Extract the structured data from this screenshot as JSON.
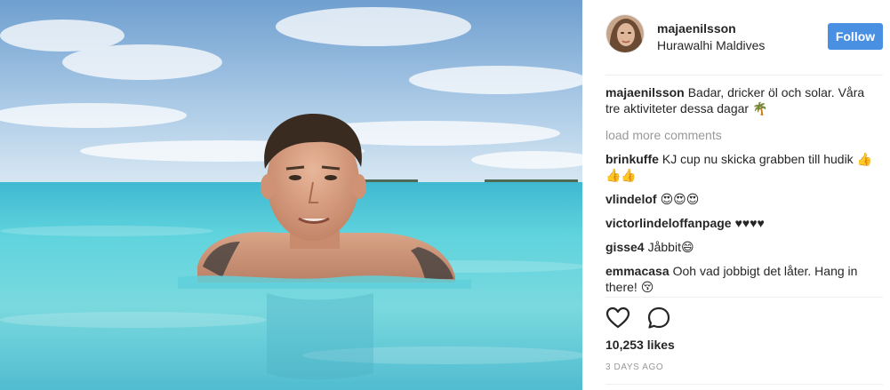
{
  "post": {
    "header": {
      "username": "majaenilsson",
      "location": "Hurawalhi Maldives",
      "follow_label": "Follow"
    },
    "caption": {
      "username": "majaenilsson",
      "text": "Badar, dricker öl och solar. Våra tre aktiviteter dessa dagar 🌴"
    },
    "load_more_label": "load more comments",
    "comments": [
      {
        "username": "brinkuffe",
        "text": "KJ cup nu skicka grabben till hudik 👍👍👍"
      },
      {
        "username": "vlindelof",
        "text": "😍😍😍"
      },
      {
        "username": "victorlindeloffanpage",
        "text": "♥♥♥♥"
      },
      {
        "username": "gisse4",
        "text": "Jåbbit😄"
      },
      {
        "username": "emmacasa",
        "text": "Ooh vad jobbigt det låter. Hang in there! 😚"
      }
    ],
    "actions": {
      "like_icon": "heart-icon",
      "comment_icon": "comment-bubble-icon"
    },
    "likes_text": "10,253 likes",
    "timestamp": "3 DAYS AGO",
    "colors": {
      "follow_button": "#4a90e2",
      "text": "#262626",
      "muted": "#999999",
      "divider": "#efefef"
    }
  }
}
